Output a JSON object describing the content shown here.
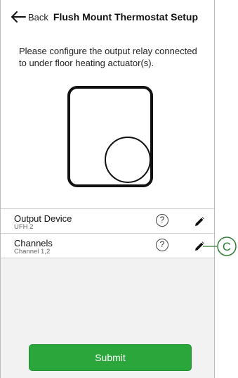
{
  "header": {
    "back_label": "Back",
    "title": "Flush Mount Thermostat Setup"
  },
  "description": "Please configure the output relay connected to under floor heating actuator(s).",
  "settings": [
    {
      "title": "Output Device",
      "value": "UFH 2",
      "help": "?",
      "edit_icon": "pencil-icon"
    },
    {
      "title": "Channels",
      "value": "Channel 1,2",
      "help": "?",
      "edit_icon": "pencil-icon"
    }
  ],
  "callout_label": "C",
  "submit_label": "Submit",
  "colors": {
    "accent": "#2aa63b",
    "callout": "#2e7d32",
    "background": "#f2f2f2"
  }
}
